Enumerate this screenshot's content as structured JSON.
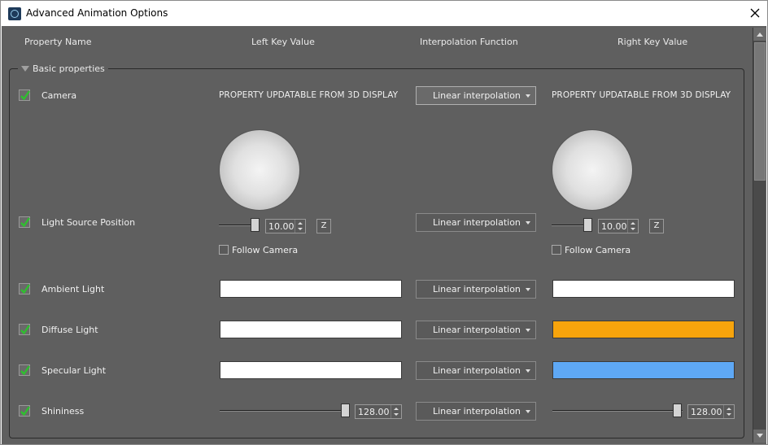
{
  "window": {
    "title": "Advanced Animation Options"
  },
  "columns": {
    "property_name": "Property Name",
    "left_key": "Left Key Value",
    "interpolation": "Interpolation Function",
    "right_key": "Right Key Value"
  },
  "group": {
    "title": "Basic properties",
    "expanded": true
  },
  "rows": {
    "camera": {
      "label": "Camera",
      "checked": true,
      "left_value": "PROPERTY UPDATABLE FROM 3D DISPLAY",
      "interpolation": "Linear interpolation",
      "right_value": "PROPERTY UPDATABLE FROM 3D DISPLAY"
    },
    "light_source": {
      "label": "Light Source Position",
      "checked": true,
      "left_spin": "10.00",
      "left_z": "Z",
      "left_follow": "Follow Camera",
      "interpolation": "Linear interpolation",
      "right_spin": "10.00",
      "right_z": "Z",
      "right_follow": "Follow Camera"
    },
    "ambient": {
      "label": "Ambient Light",
      "checked": true,
      "left_color": "#ffffff",
      "interpolation": "Linear interpolation",
      "right_color": "#ffffff"
    },
    "diffuse": {
      "label": "Diffuse Light",
      "checked": true,
      "left_color": "#ffffff",
      "interpolation": "Linear interpolation",
      "right_color": "#f7a40c"
    },
    "specular": {
      "label": "Specular Light",
      "checked": true,
      "left_color": "#ffffff",
      "interpolation": "Linear interpolation",
      "right_color": "#5ea8f5"
    },
    "shininess": {
      "label": "Shininess",
      "checked": true,
      "left_spin": "128.00",
      "interpolation": "Linear interpolation",
      "right_spin": "128.00"
    }
  },
  "colors": {
    "background": "#5f5f5f",
    "check_green": "#2fbf2f"
  }
}
